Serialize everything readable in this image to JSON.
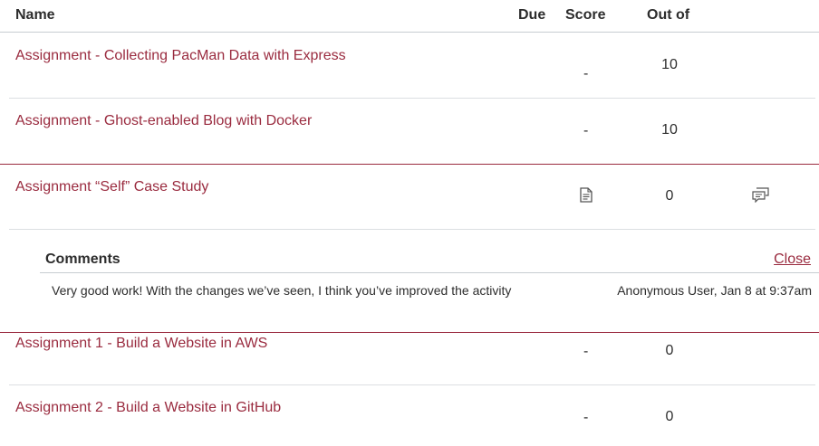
{
  "table": {
    "headers": {
      "name": "Name",
      "due": "Due",
      "score": "Score",
      "out_of": "Out of"
    },
    "rows": [
      {
        "name": "Assignment - Collecting PacMan Data with Express",
        "score": "-",
        "out_of": "10"
      },
      {
        "name": "Assignment - Ghost-enabled Blog with Docker",
        "score": "-",
        "out_of": "10"
      },
      {
        "name": "Assignment “Self” Case Study",
        "score_icon": "document-icon",
        "out_of": "0",
        "comment_icon": "comment-icon"
      },
      {
        "name": "Assignment 1 - Build a Website in AWS",
        "score": "-",
        "out_of": "0"
      },
      {
        "name": "Assignment 2 - Build a Website in GitHub",
        "score": "-",
        "out_of": "0"
      }
    ]
  },
  "comments": {
    "title": "Comments",
    "close_label": "Close",
    "items": [
      {
        "text": "Very good work! With the changes we’ve seen, I think you’ve improved the activity",
        "author": "Anonymous User, Jan 8 at 9:37am"
      }
    ]
  },
  "colors": {
    "link": "#9a2b3f",
    "text": "#2d2d2d",
    "divider": "#dcdfe2"
  }
}
